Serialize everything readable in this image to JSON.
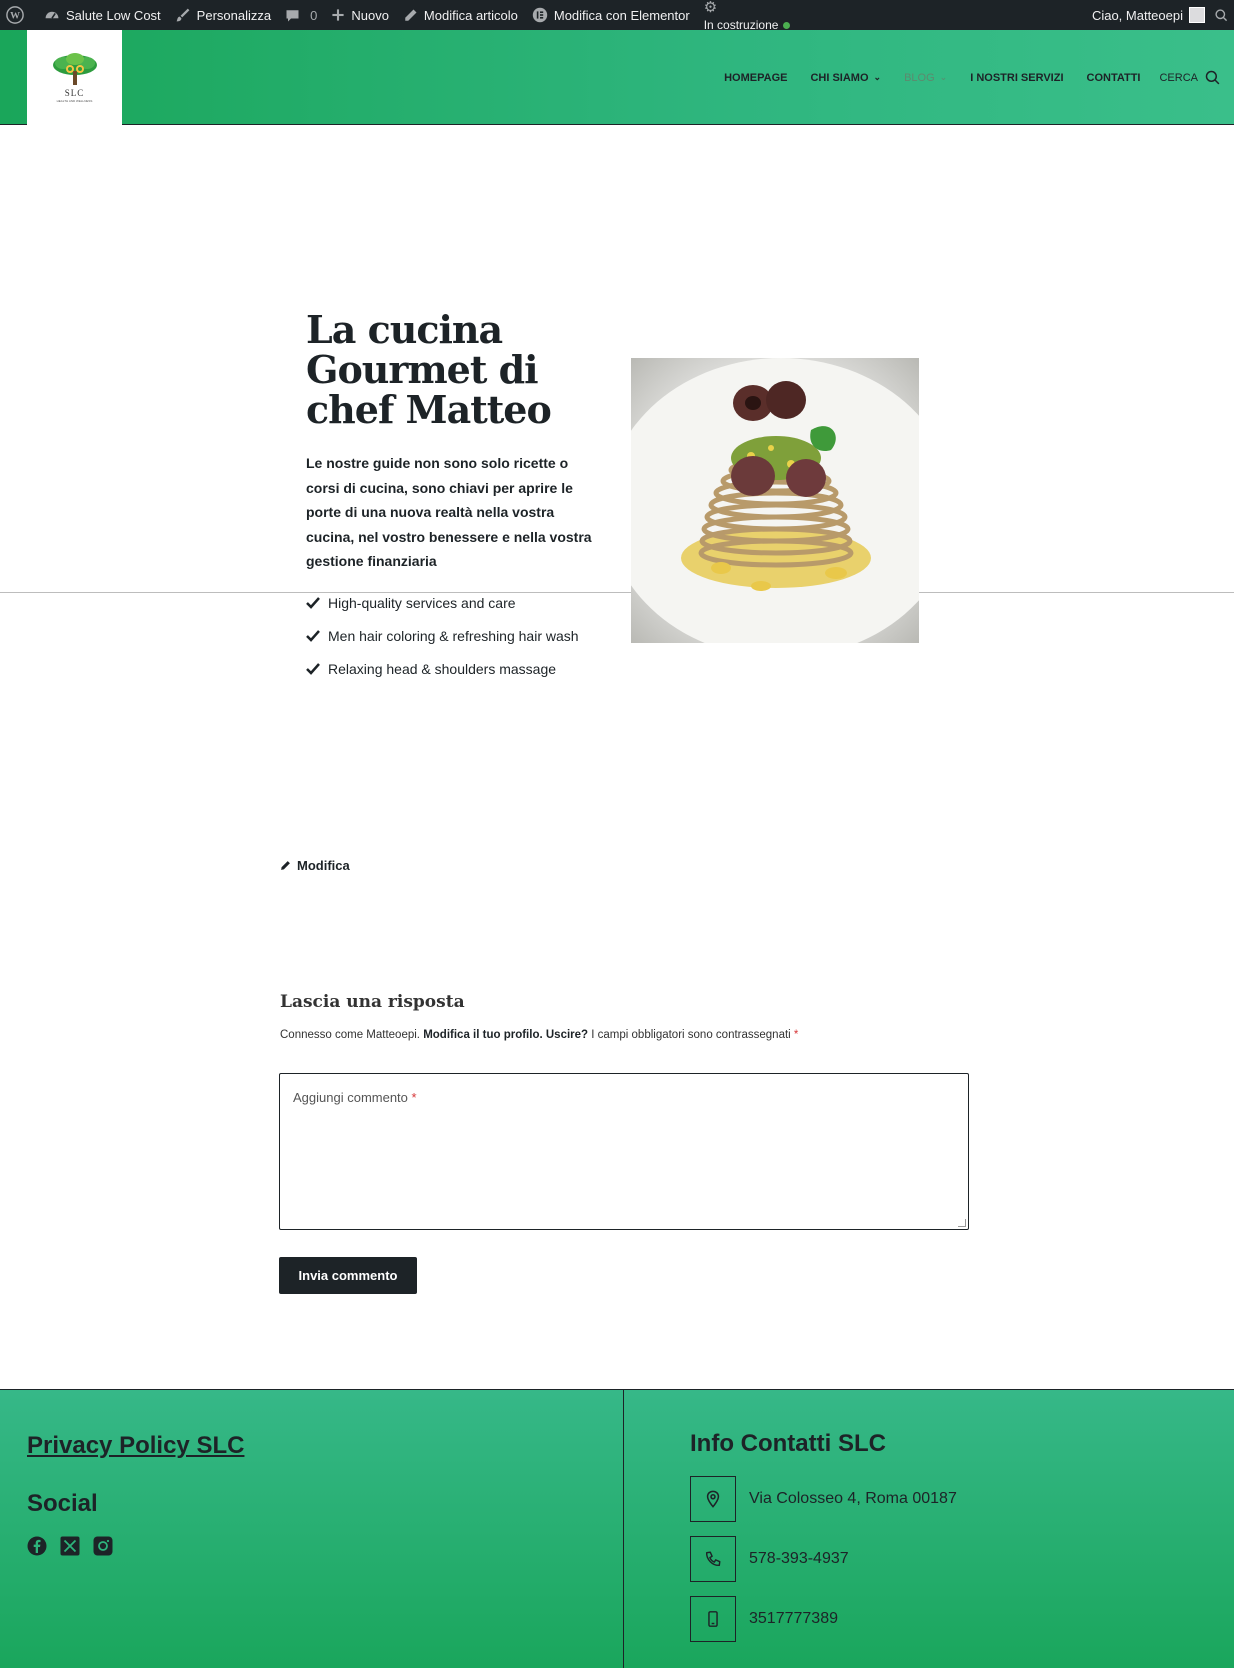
{
  "admin_bar": {
    "site_name": "Salute Low Cost",
    "customize": "Personalizza",
    "comments_count": "0",
    "new": "Nuovo",
    "edit_post": "Modifica articolo",
    "edit_elementor": "Modifica con Elementor",
    "maintenance": "In costruzione",
    "greeting": "Ciao, Matteoepi"
  },
  "header": {
    "logo_text": "SLC",
    "logo_subtext": "HEALTH AND WELLNESS",
    "nav": [
      "HOMEPAGE",
      "CHI SIAMO",
      "BLOG",
      "I NOSTRI SERVIZI",
      "CONTATTI"
    ],
    "search_label": "CERCA"
  },
  "hero": {
    "title": "La cucina Gourmet di chef Matteo",
    "text": "Le nostre guide non sono solo ricette o corsi di cucina, sono chiavi per aprire le porte di una nuova realtà nella vostra cucina, nel vostro benessere e nella vostra gestione finanziaria",
    "checklist": [
      "High-quality services and care",
      "Men hair coloring & refreshing hair wash",
      "Relaxing head & shoulders massage"
    ]
  },
  "edit_link": "Modifica",
  "comments": {
    "title": "Lascia una risposta",
    "logged_prefix": "Connesso come Matteoepi.",
    "edit_profile": "Modifica il tuo profilo.",
    "logout": "Uscire?",
    "required_note": "I campi obbligatori sono contrassegnati",
    "required_mark": "*",
    "placeholder": "Aggiungi commento",
    "submit": "Invia commento"
  },
  "footer": {
    "privacy": "Privacy Policy SLC",
    "social_title": "Social",
    "social_icons": [
      "facebook-icon",
      "x-twitter-icon",
      "instagram-icon"
    ],
    "info_title": "Info Contatti SLC",
    "contacts": [
      {
        "icon": "map-pin-icon",
        "text": "Via Colosseo 4, Roma 00187"
      },
      {
        "icon": "phone-icon",
        "text": "578-393-4937"
      },
      {
        "icon": "mobile-icon",
        "text": "3517777389"
      }
    ]
  },
  "colors": {
    "admin_bar": "#1d2327",
    "brand_green": "#2fb67f",
    "footer_green": "#1aa65c",
    "dark_button": "#1d2327"
  }
}
